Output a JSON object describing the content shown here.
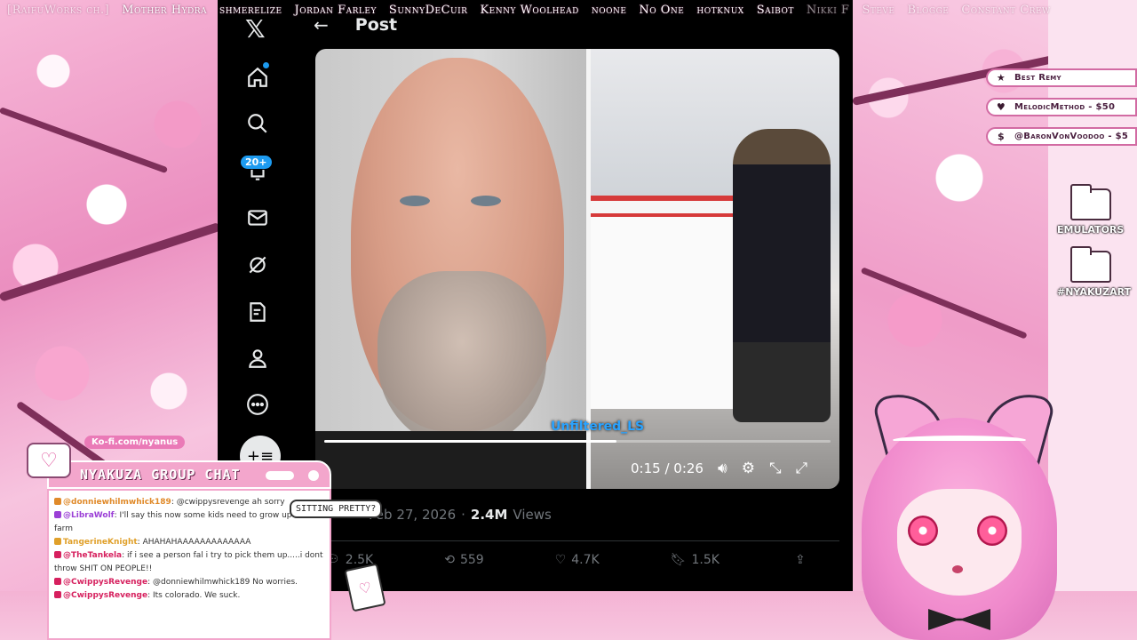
{
  "ticker": {
    "names": [
      "[RaifuWorks ch.]",
      "Mother Hydra",
      "shmerelize",
      "Jordan Farley",
      "SunnyDeCuir",
      "Kenny Woolhead",
      "noone",
      "No One",
      "hotknux",
      "Saibot",
      "Nikki F",
      "Steve",
      "Blogge",
      "Constant Crew"
    ]
  },
  "x_app": {
    "logo": "𝕏",
    "nav": {
      "notifications_badge": "20+",
      "items": [
        "home-icon",
        "search-icon",
        "bell-icon",
        "mail-icon",
        "grok-icon",
        "lists-icon",
        "profile-icon",
        "more-icon"
      ]
    },
    "compose_label": "+≡",
    "post_header": {
      "back": "←",
      "title": "Post"
    },
    "media": {
      "watermark": "Unfiltered_LS",
      "time": "0:15 / 0:26",
      "progress_fraction": 0.577
    },
    "meta": {
      "date": "Feb 27, 2026",
      "separator": "·",
      "views_count": "2.4M",
      "views_label": "Views"
    },
    "actions": {
      "replies": "2.5K",
      "reposts": "559",
      "likes": "4.7K",
      "bookmarks": "1.5K"
    }
  },
  "support": [
    {
      "icon": "★",
      "text": "Best Remy"
    },
    {
      "icon": "♥",
      "text": "MelodicMethod - $50"
    },
    {
      "icon": "$",
      "text": "@BaronVonVoodoo - $5"
    }
  ],
  "folders": [
    "EMULATORS",
    "#NYAKUZART"
  ],
  "chat": {
    "kofi": "Ko-fi.com/nyanus",
    "title": "NYAKUZA GROUP CHAT",
    "heart": "♡",
    "messages": [
      {
        "user": "@donniewhilmwhick189",
        "color": "#e08a2a",
        "text": "@cwippysrevenge ah sorry"
      },
      {
        "user": "@LibraWolf",
        "color": "#9b3fd6",
        "text": "I'll say this now some kids need to grow up on a farm"
      },
      {
        "user": "TangerineKnight",
        "color": "#e0a02a",
        "text": "AHAHAHAAAAAAAAAAAAA"
      },
      {
        "user": "@TheTankela",
        "color": "#d6205e",
        "text": "if i see a person fal i try to pick them up.....i dont throw SHIT ON PEOPLE!!"
      },
      {
        "user": "@CwippysRevenge",
        "color": "#d6205e",
        "text": "@donniewhilmwhick189 No worries."
      },
      {
        "user": "@CwippysRevenge",
        "color": "#d6205e",
        "text": "Its colorado. We suck."
      }
    ],
    "sitting_pretty": "SITTING PRETTY?"
  }
}
